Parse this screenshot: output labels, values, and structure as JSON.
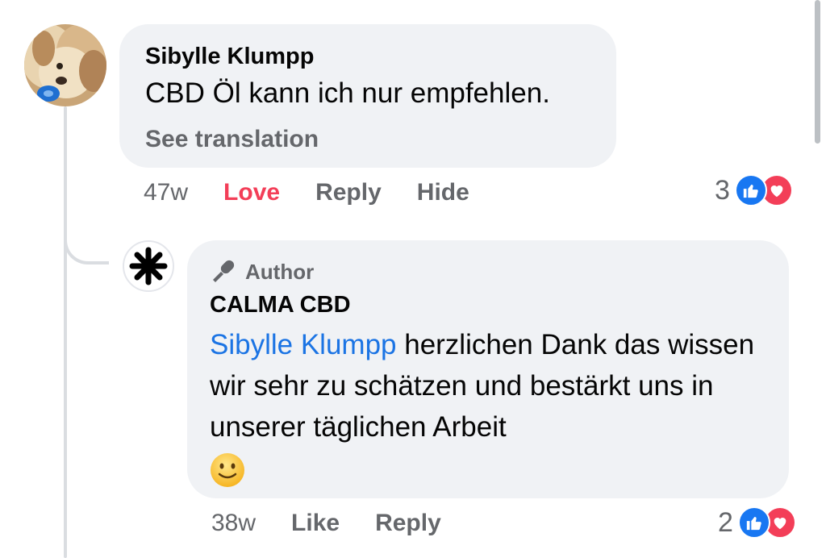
{
  "comment": {
    "author": "Sibylle Klumpp",
    "text": "CBD Öl kann ich nur empfehlen.",
    "translate": "See translation",
    "time": "47w",
    "actions": {
      "love": "Love",
      "reply": "Reply",
      "hide": "Hide"
    },
    "reaction_count": "3",
    "reactions": [
      "like-icon",
      "love-icon"
    ]
  },
  "reply": {
    "badge": "Author",
    "author": "CALMA CBD",
    "mention": "Sibylle Klumpp",
    "text": " herzlichen Dank das wissen wir sehr zu schätzen und bestärkt uns in unserer täglichen Arbeit",
    "emoji": "slightly-smiling-face",
    "time": "38w",
    "actions": {
      "like": "Like",
      "reply": "Reply"
    },
    "reaction_count": "2",
    "reactions": [
      "like-icon",
      "love-icon"
    ]
  },
  "colors": {
    "bubble": "#f0f2f5",
    "secondary_text": "#65676b",
    "mention": "#1b74e4",
    "love": "#f33e58",
    "like": "#1877f2"
  }
}
